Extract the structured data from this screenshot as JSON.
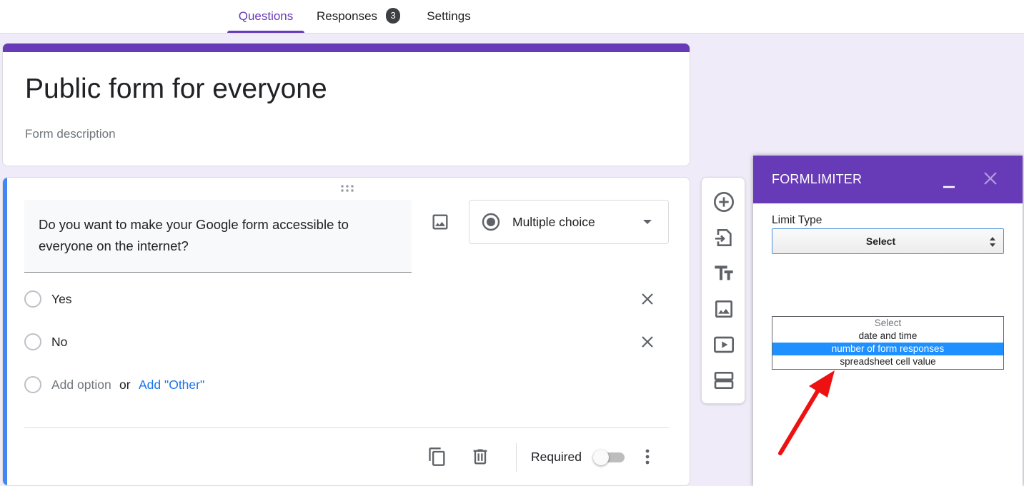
{
  "tabs": [
    {
      "label": "Questions",
      "active": true
    },
    {
      "label": "Responses",
      "badge": "3"
    },
    {
      "label": "Settings"
    }
  ],
  "form": {
    "title": "Public form for everyone",
    "description": "Form description"
  },
  "question": {
    "text": "Do you want to make your Google form accessible to everyone  on the internet?",
    "type_label": "Multiple choice",
    "options": [
      {
        "label": "Yes"
      },
      {
        "label": "No"
      }
    ],
    "add_option": "Add option",
    "or_text": "or",
    "add_other": "Add \"Other\"",
    "required_label": "Required",
    "required_on": false
  },
  "side_toolbar": {
    "icons": [
      "add-question-icon",
      "import-questions-icon",
      "add-title-icon",
      "add-image-icon",
      "add-video-icon",
      "add-section-icon"
    ]
  },
  "addon": {
    "title": "FORMLIMITER",
    "limit_type_label": "Limit Type",
    "select_value": "Select",
    "dropdown_options": [
      {
        "label": "Select",
        "state": "placeholder"
      },
      {
        "label": "date and time",
        "state": "normal"
      },
      {
        "label": "number of form responses",
        "state": "selected"
      },
      {
        "label": "spreadsheet cell value",
        "state": "normal"
      }
    ]
  },
  "colors": {
    "brand": "#673ab7",
    "background": "#f0ebf8",
    "focus_accent": "#4285f4",
    "link": "#1a73e8",
    "dropdown_highlight": "#1e90ff",
    "annotation_arrow": "#ee1111"
  }
}
